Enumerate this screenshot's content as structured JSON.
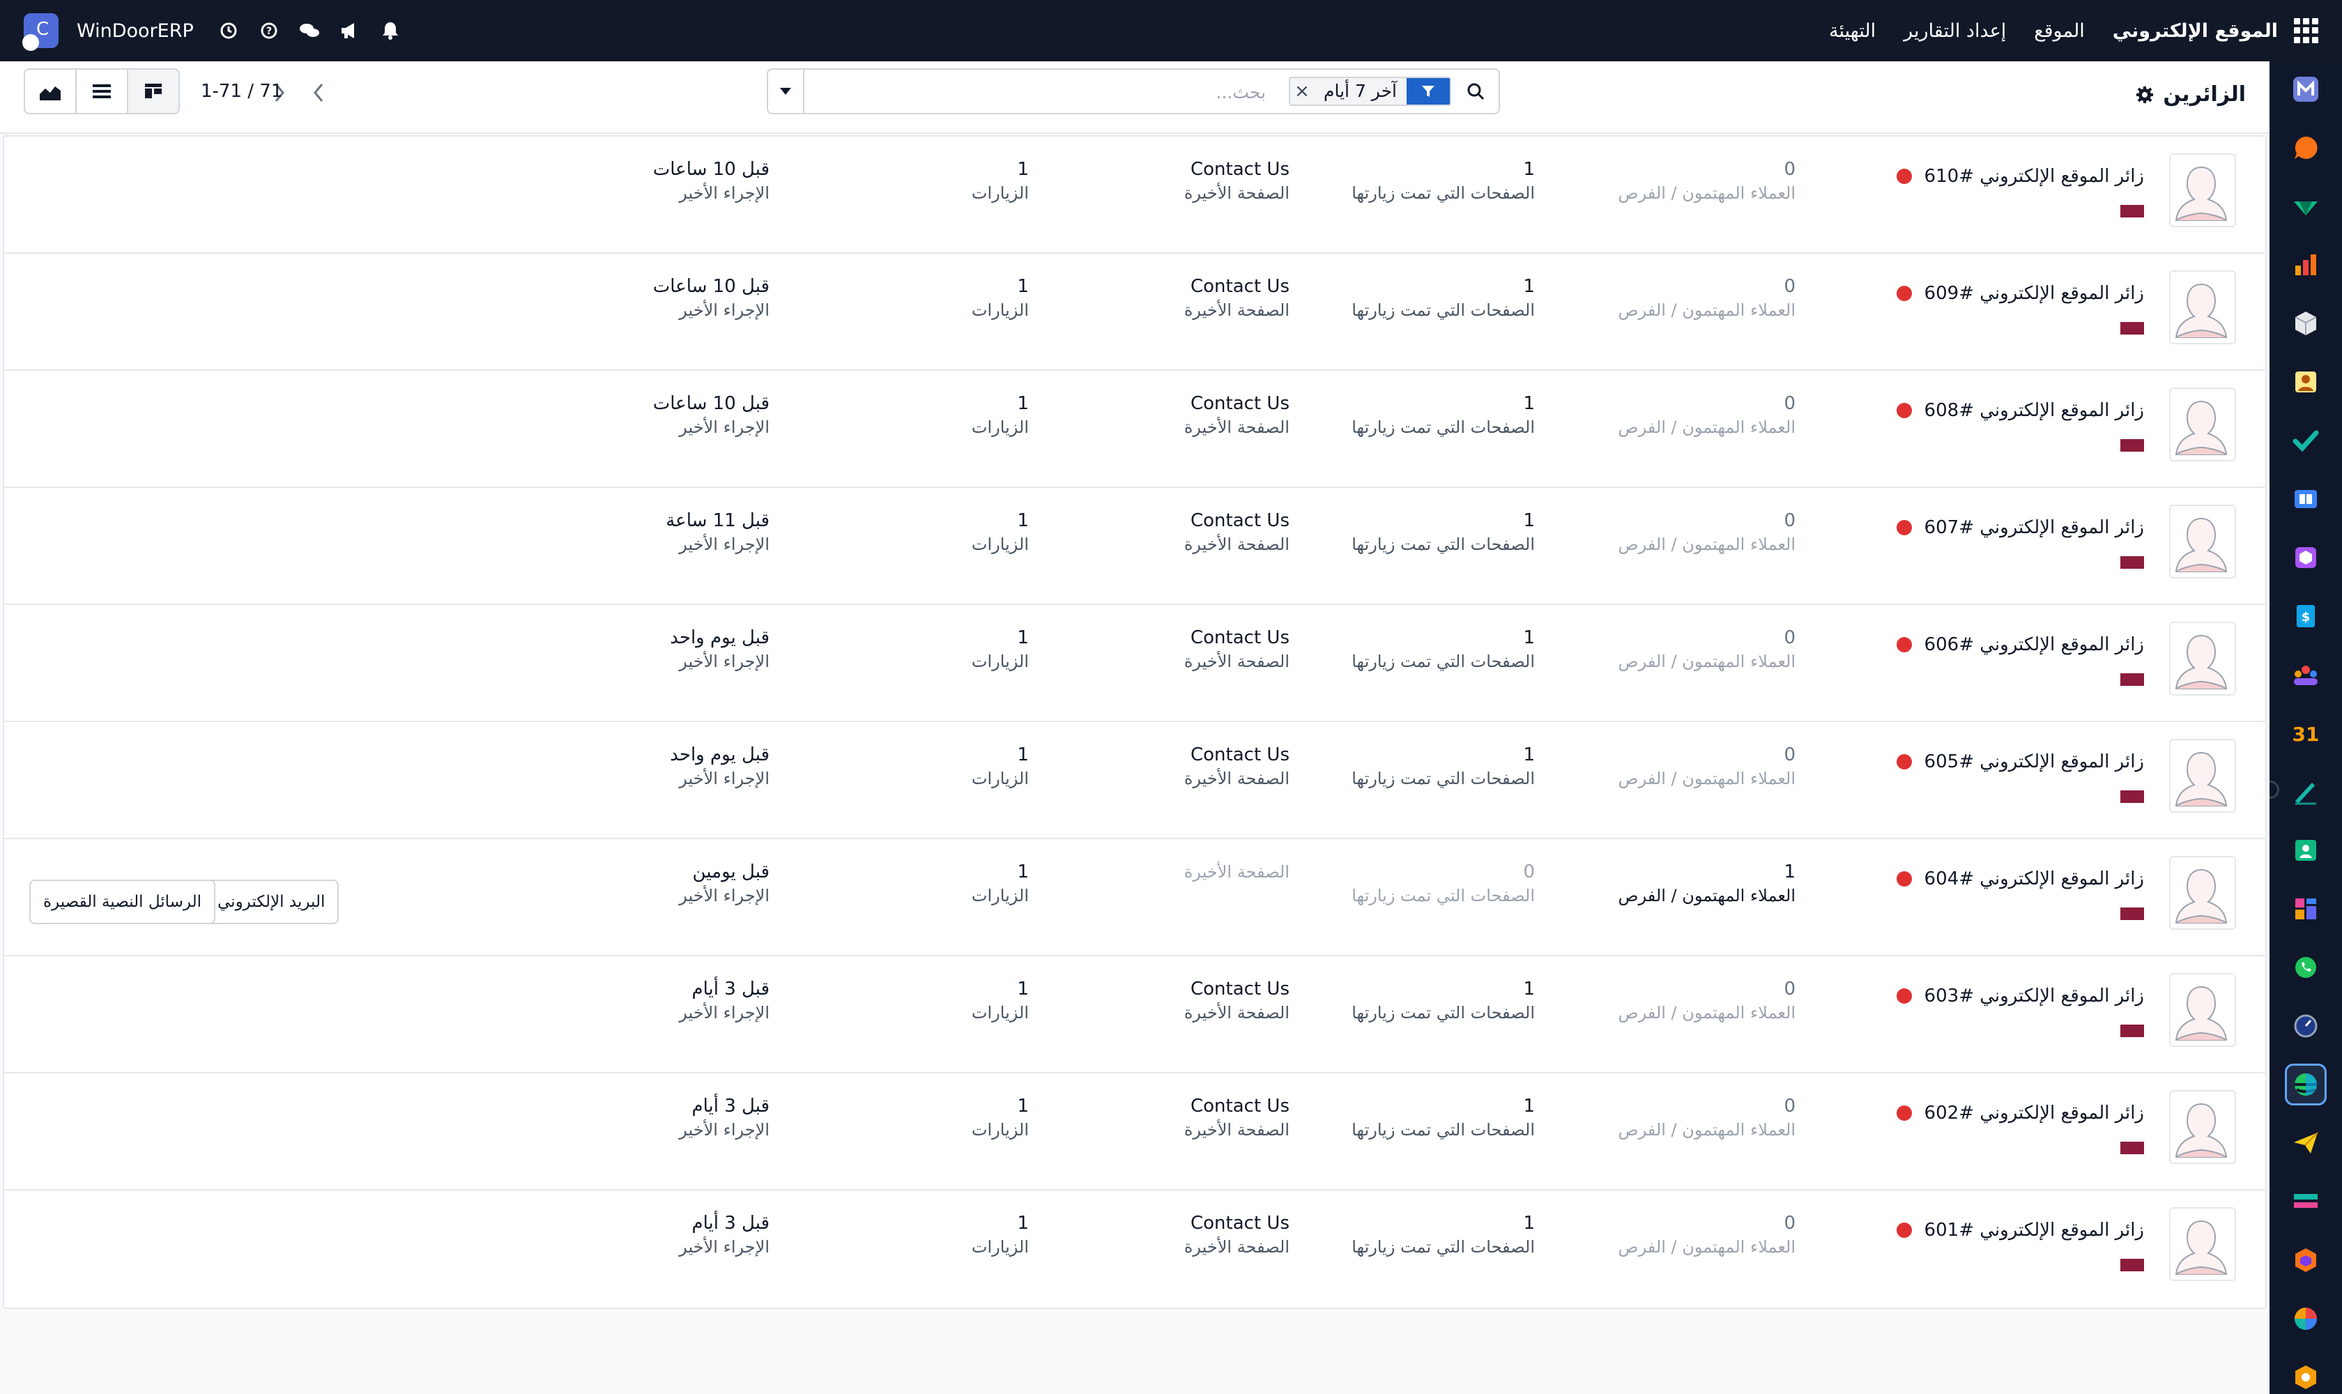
{
  "topbar": {
    "menu": [
      "الموقع الإلكتروني",
      "الموقع",
      "إعداد التقارير",
      "التهيئة"
    ],
    "company": "WinDoorERP"
  },
  "control": {
    "title": "الزائرين",
    "filter_facet": "آخر 7 أيام",
    "search_placeholder": "بحث...",
    "pager": "1-71 / 71"
  },
  "labels": {
    "last_action": "الإجراء الأخير",
    "visits": "الزيارات",
    "last_page": "الصفحة الأخيرة",
    "pages_visited": "الصفحات التي تمت زيارتها",
    "leads": "العملاء المهتمون / الفرص"
  },
  "actions": {
    "email": "البريد الإلكتروني",
    "sms": "الرسائل النصية القصيرة"
  },
  "records": [
    {
      "name": "زائر الموقع الإلكتروني #610",
      "last_action": "قبل 10 ساعات",
      "visits": "1",
      "last_page": "Contact Us",
      "pages_visited": "1",
      "leads": "0"
    },
    {
      "name": "زائر الموقع الإلكتروني #609",
      "last_action": "قبل 10 ساعات",
      "visits": "1",
      "last_page": "Contact Us",
      "pages_visited": "1",
      "leads": "0"
    },
    {
      "name": "زائر الموقع الإلكتروني #608",
      "last_action": "قبل 10 ساعات",
      "visits": "1",
      "last_page": "Contact Us",
      "pages_visited": "1",
      "leads": "0"
    },
    {
      "name": "زائر الموقع الإلكتروني #607",
      "last_action": "قبل 11 ساعة",
      "visits": "1",
      "last_page": "Contact Us",
      "pages_visited": "1",
      "leads": "0"
    },
    {
      "name": "زائر الموقع الإلكتروني #606",
      "last_action": "قبل يوم واحد",
      "visits": "1",
      "last_page": "Contact Us",
      "pages_visited": "1",
      "leads": "0"
    },
    {
      "name": "زائر الموقع الإلكتروني #605",
      "last_action": "قبل يوم واحد",
      "visits": "1",
      "last_page": "Contact Us",
      "pages_visited": "1",
      "leads": "0"
    },
    {
      "name": "زائر الموقع الإلكتروني #604",
      "last_action": "قبل يومين",
      "visits": "1",
      "last_page": "",
      "pages_visited": "0",
      "leads": "1"
    },
    {
      "name": "زائر الموقع الإلكتروني #603",
      "last_action": "قبل 3 أيام",
      "visits": "1",
      "last_page": "Contact Us",
      "pages_visited": "1",
      "leads": "0"
    },
    {
      "name": "زائر الموقع الإلكتروني #602",
      "last_action": "قبل 3 أيام",
      "visits": "1",
      "last_page": "Contact Us",
      "pages_visited": "1",
      "leads": "0"
    },
    {
      "name": "زائر الموقع الإلكتروني #601",
      "last_action": "قبل 3 أيام",
      "visits": "1",
      "last_page": "Contact Us",
      "pages_visited": "1",
      "leads": "0"
    }
  ],
  "colors": {
    "navbar": "#111827",
    "sidebar": "#0f172a",
    "accent": "#1d63c9",
    "status_dot": "#e03131",
    "flag": "#8b1c3c"
  },
  "sidebar_apps": [
    "mail-app-icon",
    "discuss-app-icon",
    "inventory-app-icon",
    "reporting-app-icon",
    "product-app-icon",
    "contacts-app-icon",
    "todo-app-icon",
    "knowledge-app-icon",
    "box-app-icon",
    "invoicing-app-icon",
    "employees-app-icon",
    "calendar-app-icon",
    "sign-app-icon",
    "contacts-card-app-icon",
    "dashboards-app-icon",
    "whatsapp-app-icon",
    "timer-app-icon",
    "website-app-icon",
    "email-marketing-app-icon",
    "bank-app-icon",
    "odoo-cube-app-icon",
    "pie-app-icon",
    "hexagon-app-icon"
  ]
}
